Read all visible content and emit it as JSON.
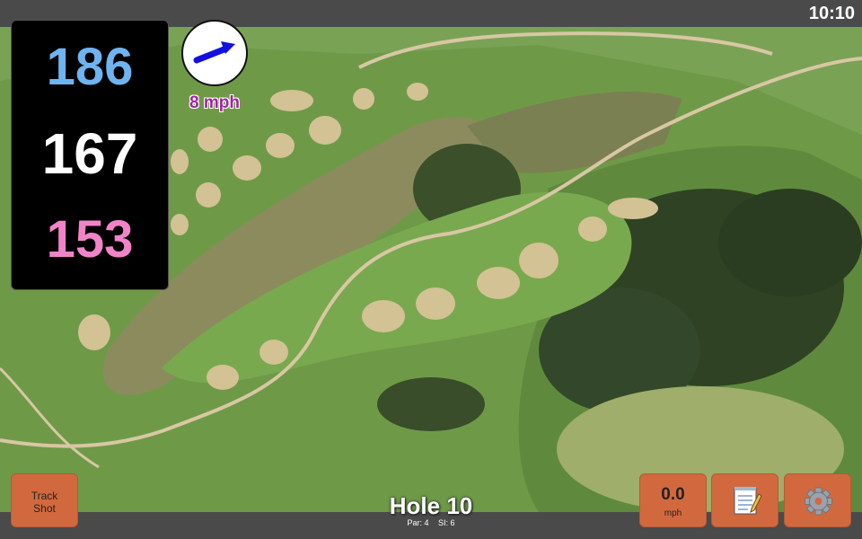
{
  "status_bar": {
    "time": "10:10"
  },
  "yardages": {
    "back": "186",
    "middle": "167",
    "front": "153",
    "colors": {
      "back": "#6fb4f0",
      "middle": "#ffffff",
      "front": "#f184c8"
    }
  },
  "wind": {
    "speed": "8 mph",
    "direction_icon": "arrow-icon",
    "speed_color": "#a0279f"
  },
  "track_shot": {
    "label": "Track\nShot"
  },
  "speed_widget": {
    "value": "0.0",
    "unit": "mph"
  },
  "notes": {
    "icon": "notepad-icon"
  },
  "settings": {
    "icon": "gear-icon"
  },
  "hole": {
    "title": "Hole 10",
    "par": "Par: 4",
    "si": "SI: 6"
  },
  "colors": {
    "button": "#d2693e",
    "bars": "#4a4a4a",
    "fairway": "#6f9c4a"
  }
}
